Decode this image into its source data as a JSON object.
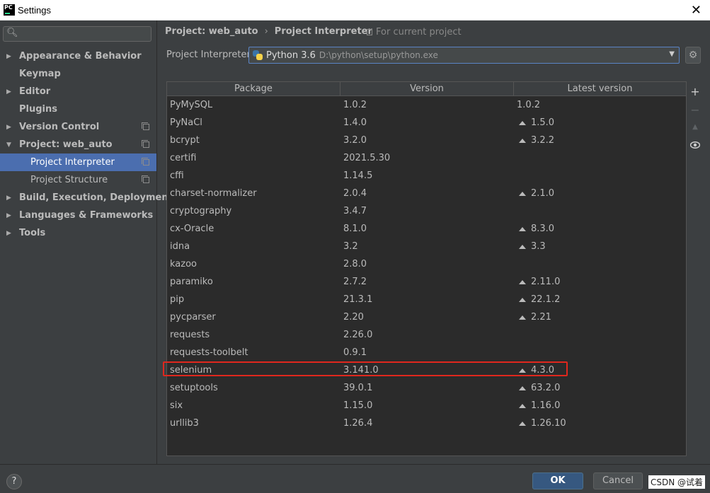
{
  "window": {
    "title": "Settings",
    "app_icon_text": "PC",
    "close_glyph": "✕"
  },
  "sidebar": {
    "search_placeholder": "",
    "items": [
      {
        "label": "Appearance & Behavior",
        "expandable": true,
        "bold": true
      },
      {
        "label": "Keymap",
        "expandable": false,
        "bold": true
      },
      {
        "label": "Editor",
        "expandable": true,
        "bold": true
      },
      {
        "label": "Plugins",
        "expandable": false,
        "bold": true
      },
      {
        "label": "Version Control",
        "expandable": true,
        "bold": true
      },
      {
        "label": "Project: web_auto",
        "expandable": true,
        "expanded": true,
        "bold": true
      },
      {
        "label": "Project Interpreter",
        "child": true,
        "selected": true
      },
      {
        "label": "Project Structure",
        "child": true
      },
      {
        "label": "Build, Execution, Deployment",
        "expandable": true,
        "bold": true
      },
      {
        "label": "Languages & Frameworks",
        "expandable": true,
        "bold": true
      },
      {
        "label": "Tools",
        "expandable": true,
        "bold": true
      }
    ]
  },
  "breadcrumb": {
    "parent": "Project: web_auto",
    "separator": "›",
    "current": "Project Interpreter",
    "scope": "For current project"
  },
  "interpreter": {
    "label": "Project Interpreter:",
    "name": "Python 3.6",
    "path": "D:\\python\\setup\\python.exe"
  },
  "table": {
    "headers": [
      "Package",
      "Version",
      "Latest version"
    ],
    "rows": [
      {
        "package": "PyMySQL",
        "version": "1.0.2",
        "latest": "1.0.2",
        "upgrade": false
      },
      {
        "package": "PyNaCl",
        "version": "1.4.0",
        "latest": "1.5.0",
        "upgrade": true
      },
      {
        "package": "bcrypt",
        "version": "3.2.0",
        "latest": "3.2.2",
        "upgrade": true
      },
      {
        "package": "certifi",
        "version": "2021.5.30",
        "latest": "",
        "upgrade": false
      },
      {
        "package": "cffi",
        "version": "1.14.5",
        "latest": "",
        "upgrade": false
      },
      {
        "package": "charset-normalizer",
        "version": "2.0.4",
        "latest": "2.1.0",
        "upgrade": true
      },
      {
        "package": "cryptography",
        "version": "3.4.7",
        "latest": "",
        "upgrade": false
      },
      {
        "package": "cx-Oracle",
        "version": "8.1.0",
        "latest": "8.3.0",
        "upgrade": true
      },
      {
        "package": "idna",
        "version": "3.2",
        "latest": "3.3",
        "upgrade": true
      },
      {
        "package": "kazoo",
        "version": "2.8.0",
        "latest": "",
        "upgrade": false
      },
      {
        "package": "paramiko",
        "version": "2.7.2",
        "latest": "2.11.0",
        "upgrade": true
      },
      {
        "package": "pip",
        "version": "21.3.1",
        "latest": "22.1.2",
        "upgrade": true
      },
      {
        "package": "pycparser",
        "version": "2.20",
        "latest": "2.21",
        "upgrade": true
      },
      {
        "package": "requests",
        "version": "2.26.0",
        "latest": "",
        "upgrade": false
      },
      {
        "package": "requests-toolbelt",
        "version": "0.9.1",
        "latest": "",
        "upgrade": false
      },
      {
        "package": "selenium",
        "version": "3.141.0",
        "latest": "4.3.0",
        "upgrade": true,
        "highlighted": true
      },
      {
        "package": "setuptools",
        "version": "39.0.1",
        "latest": "63.2.0",
        "upgrade": true
      },
      {
        "package": "six",
        "version": "1.15.0",
        "latest": "1.16.0",
        "upgrade": true
      },
      {
        "package": "urllib3",
        "version": "1.26.4",
        "latest": "1.26.10",
        "upgrade": true
      }
    ]
  },
  "side_tools": {
    "add": "+",
    "remove": "−",
    "upgrade": "▲",
    "show": "👁"
  },
  "footer": {
    "help": "?",
    "ok": "OK",
    "cancel": "Cancel",
    "watermark": "CSDN @试着"
  },
  "colors": {
    "selection": "#4b6eaf",
    "highlight_box": "#e0271d",
    "ok_button": "#365880"
  }
}
